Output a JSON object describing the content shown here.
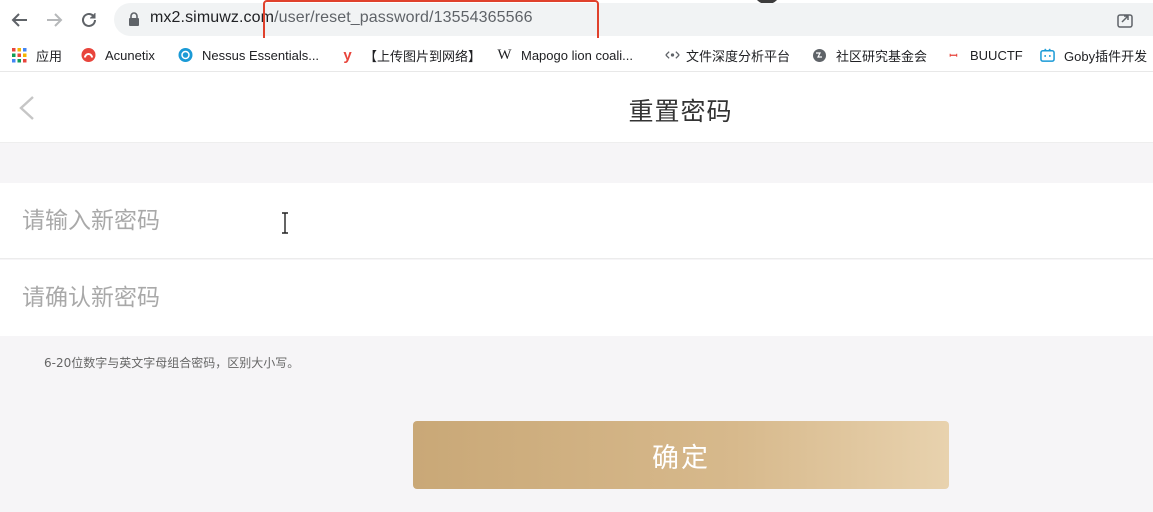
{
  "browser": {
    "url_host": "mx2.simuwz.com",
    "url_path": "/user/reset_password/13554365566"
  },
  "bookmarks": [
    {
      "label": "应用",
      "icon": "apps-grid-icon",
      "color": "#e8453c"
    },
    {
      "label": "Acunetix",
      "icon": "acunetix-icon",
      "color": "#e8453c"
    },
    {
      "label": "Nessus Essentials...",
      "icon": "nessus-icon",
      "color": "#1a9ad6"
    },
    {
      "label": "【上传图片到网络】",
      "icon": "y-logo-icon",
      "color": "#e8453c"
    },
    {
      "label": "Mapogo lion coali...",
      "icon": "wikipedia-icon",
      "color": "#202124"
    },
    {
      "label": "文件深度分析平台",
      "icon": "analysis-icon",
      "color": "#5f6368"
    },
    {
      "label": "社区研究基金会",
      "icon": "globe-icon",
      "color": "#5f6368"
    },
    {
      "label": "BUUCTF",
      "icon": "buuctf-icon",
      "color": "#e8453c"
    },
    {
      "label": "Goby插件开发",
      "icon": "bilibili-icon",
      "color": "#1a9ad6"
    }
  ],
  "app": {
    "title": "重置密码",
    "new_password_placeholder": "请输入新密码",
    "confirm_password_placeholder": "请确认新密码",
    "hint": "6-20位数字与英文字母组合密码，区别大小写。",
    "confirm_label": "确定"
  },
  "colors": {
    "accent_gold": "#c9a877",
    "highlight_red": "#e0412c"
  }
}
